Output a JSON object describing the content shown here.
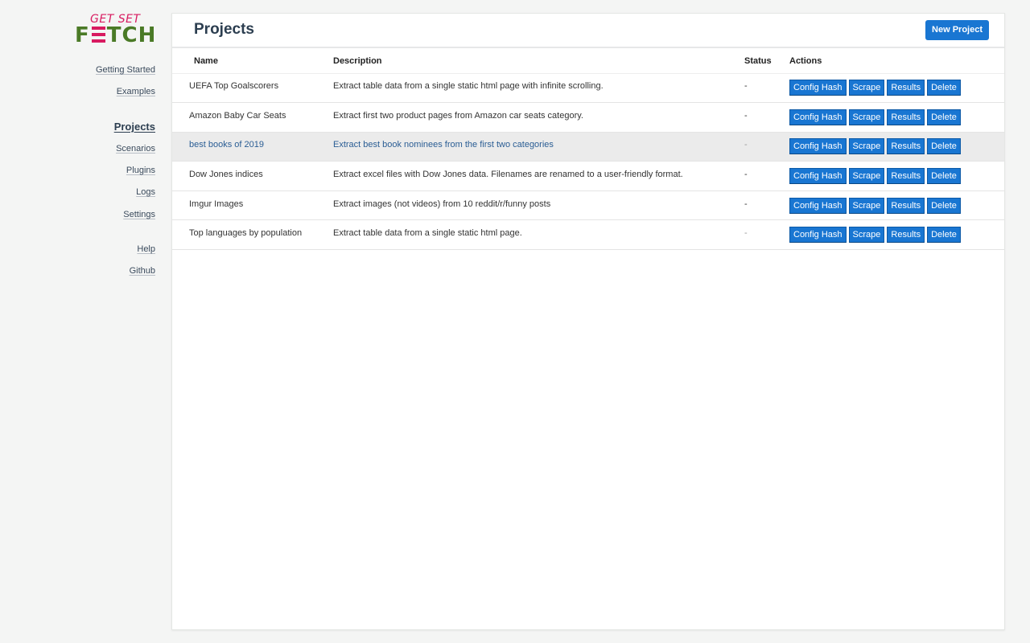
{
  "logo": {
    "line1": "GET SET",
    "line2_pre": "F",
    "line2_post": "TCH",
    "alt": "Get Set Fetch"
  },
  "colors": {
    "accent": "#1976d2",
    "logo_pink": "#d81b60",
    "logo_green": "#4a7a26",
    "title": "#2c3e50"
  },
  "sidebar": {
    "items": [
      {
        "label": "Getting Started",
        "active": false
      },
      {
        "label": "Examples",
        "active": false
      },
      {
        "label": "Projects",
        "active": true
      },
      {
        "label": "Scenarios",
        "active": false
      },
      {
        "label": "Plugins",
        "active": false
      },
      {
        "label": "Logs",
        "active": false
      },
      {
        "label": "Settings",
        "active": false
      },
      {
        "label": "Help",
        "active": false
      },
      {
        "label": "Github",
        "active": false
      }
    ]
  },
  "header": {
    "title": "Projects",
    "new_button": "New Project"
  },
  "table": {
    "columns": [
      "Name",
      "Description",
      "Status",
      "Actions"
    ],
    "action_labels": [
      "Config Hash",
      "Scrape",
      "Results",
      "Delete"
    ],
    "rows": [
      {
        "name": "UEFA Top Goalscorers",
        "description": "Extract table data from a single static html page with infinite scrolling.",
        "status": "-"
      },
      {
        "name": "Amazon Baby Car Seats",
        "description": "Extract first two product pages from Amazon car seats category.",
        "status": "-"
      },
      {
        "name": "best books of 2019",
        "description": "Extract best book nominees from the first two categories",
        "status": "-"
      },
      {
        "name": "Dow Jones indices",
        "description": "Extract excel files with Dow Jones data. Filenames are renamed to a user-friendly format.",
        "status": "-"
      },
      {
        "name": "Imgur Images",
        "description": "Extract images (not videos) from 10 reddit/r/funny posts",
        "status": "-"
      },
      {
        "name": "Top languages by population",
        "description": "Extract table data from a single static html page.",
        "status": "-"
      }
    ]
  }
}
